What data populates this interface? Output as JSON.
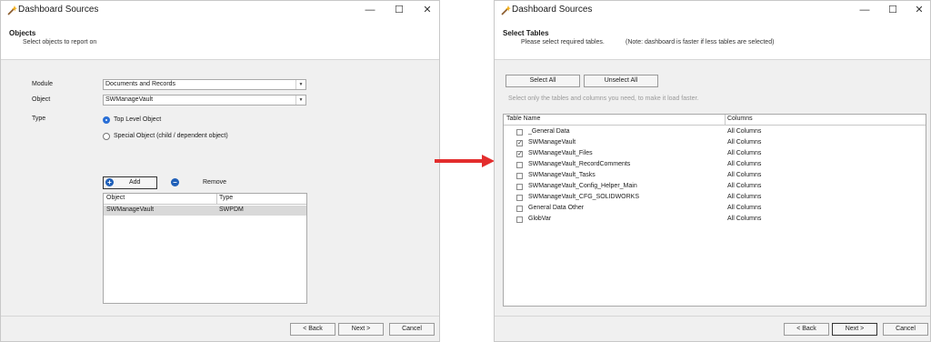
{
  "left": {
    "title": "Dashboard Sources",
    "window_controls": {
      "minimize": "—",
      "maximize": "☐",
      "close": "✕"
    },
    "header": {
      "title": "Objects",
      "subtitle": "Select objects to report on"
    },
    "module": {
      "label": "Module",
      "value": "Documents and Records"
    },
    "object": {
      "label": "Object",
      "value": "SWManageVault"
    },
    "type": {
      "label": "Type",
      "option1": "Top Level Object",
      "option2": "Special Object (child / dependent object)"
    },
    "add_label": "Add",
    "remove_label": "Remove",
    "grid": {
      "col1": "Object",
      "col2": "Type",
      "rows": [
        {
          "object": "SWManageVault",
          "type": "SWPDM"
        }
      ]
    },
    "back_label": "< Back",
    "next_label": "Next >",
    "cancel_label": "Cancel"
  },
  "right": {
    "title": "Dashboard Sources",
    "window_controls": {
      "minimize": "—",
      "maximize": "☐",
      "close": "✕"
    },
    "header": {
      "title": "Select Tables",
      "subtitle": "Please select required tables.",
      "note": "(Note: dashboard is faster if less tables are selected)"
    },
    "select_all_label": "Select All",
    "unselect_all_label": "Unselect All",
    "hint": "Select only the tables and columns you need, to make it load faster.",
    "grid": {
      "col1": "Table Name",
      "col2": "Columns",
      "rows": [
        {
          "name": "_General Data",
          "columns": "All Columns",
          "checked": false
        },
        {
          "name": "SWManageVault",
          "columns": "All Columns",
          "checked": true
        },
        {
          "name": "SWManageVault_Files",
          "columns": "All Columns",
          "checked": true
        },
        {
          "name": "SWManageVault_RecordComments",
          "columns": "All Columns",
          "checked": false
        },
        {
          "name": "SWManageVault_Tasks",
          "columns": "All Columns",
          "checked": false
        },
        {
          "name": "SWManageVault_Config_Helper_Main",
          "columns": "All Columns",
          "checked": false
        },
        {
          "name": "SWManageVault_CFG_SOLIDWORKS",
          "columns": "All Columns",
          "checked": false
        },
        {
          "name": "General Data Other",
          "columns": "All Columns",
          "checked": false
        },
        {
          "name": "GlobVar",
          "columns": "All Columns",
          "checked": false
        }
      ]
    },
    "back_label": "< Back",
    "next_label": "Next >",
    "cancel_label": "Cancel"
  },
  "colors": {
    "accent": "#2a6fd6",
    "arrow": "#e32d2d",
    "selected_row": "#d9d9d9"
  }
}
